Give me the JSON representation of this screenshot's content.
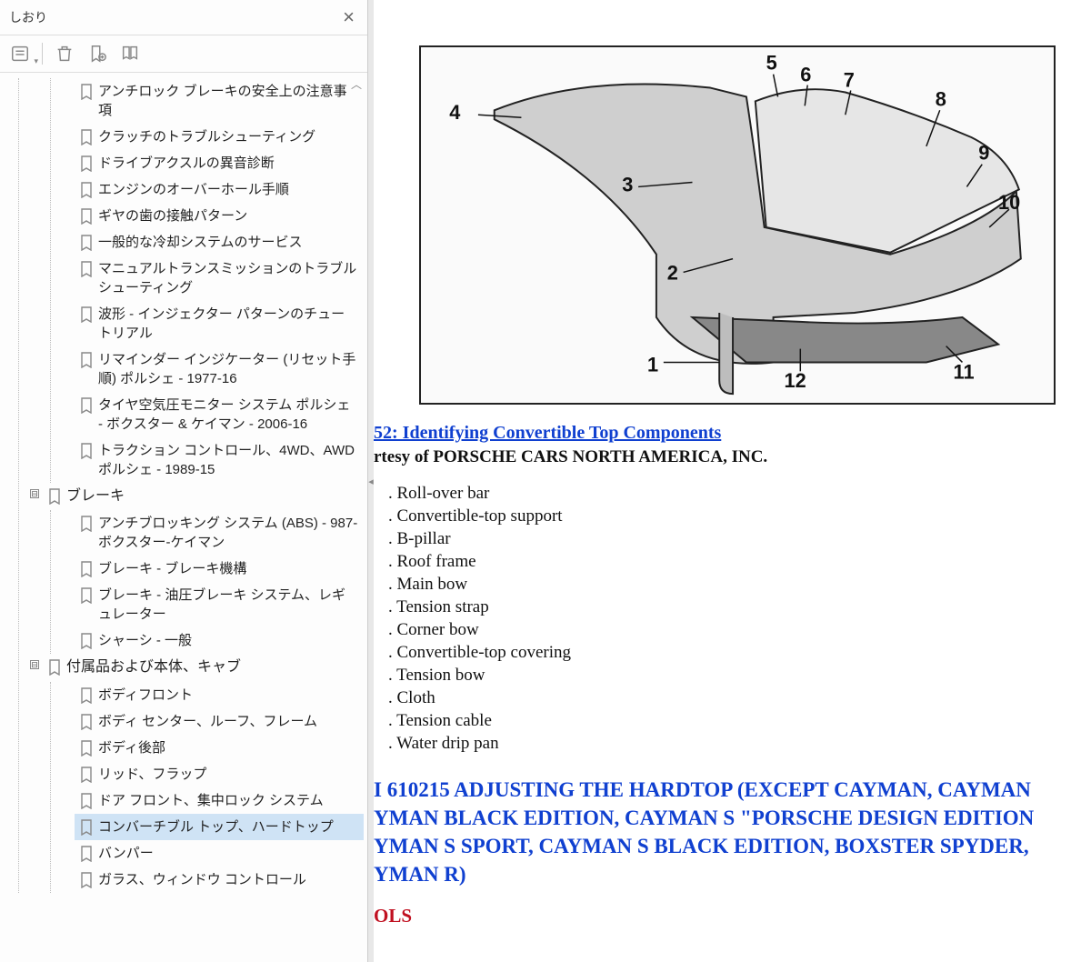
{
  "sidebar": {
    "title": "しおり",
    "close_label": "×",
    "bookmarks_level1": [
      "アンチロック ブレーキの安全上の注意事項",
      "クラッチのトラブルシューティング",
      "ドライブアクスルの異音診断",
      "エンジンのオーバーホール手順",
      "ギヤの歯の接触パターン",
      " 一般的な冷却システムのサービス",
      "マニュアルトランスミッションのトラブルシューティング",
      "波形 - インジェクター パターンのチュートリアル",
      "リマインダー インジケーター (リセット手順) ポルシェ - 1977-16",
      "タイヤ空気圧モニター システム ポルシェ - ボクスター & ケイマン - 2006-16",
      "トラクション コントロール、4WD、AWD ポルシェ - 1989-15"
    ],
    "group_brake": {
      "label": "ブレーキ",
      "children": [
        "アンチブロッキング システム (ABS) - 987-ボクスター-ケイマン",
        "ブレーキ - ブレーキ機構",
        "ブレーキ - 油圧ブレーキ システム、レギュレーター",
        "シャーシ - 一般"
      ]
    },
    "group_body": {
      "label": "付属品および本体、キャブ",
      "children": [
        "ボディフロント",
        " ボディ センター、ルーフ、フレーム",
        "ボディ後部",
        "リッド、フラップ",
        "ドア フロント、集中ロック システム",
        "コンバーチブル トップ、ハードトップ",
        "バンパー",
        "ガラス、ウィンドウ コントロール"
      ],
      "selected_index": 5
    }
  },
  "content": {
    "figure_caption": "52: Identifying Convertible Top Components",
    "courtesy": "rtesy of PORSCHE CARS NORTH AMERICA, INC.",
    "parts": [
      "Roll-over bar",
      "Convertible-top support",
      "B-pillar",
      "Roof frame",
      "Main bow",
      "Tension strap",
      "Corner bow",
      "Convertible-top covering",
      "Tension bow",
      "Cloth",
      "Tension cable",
      "Water drip pan"
    ],
    "section_heading": "I 610215 ADJUSTING THE HARDTOP (EXCEPT CAYMAN, CAYMAN YMAN BLACK EDITION, CAYMAN S \"PORSCHE DESIGN EDITION YMAN S SPORT, CAYMAN S BLACK EDITION, BOXSTER SPYDER, YMAN R)",
    "tools_heading": "OLS",
    "callouts": [
      "1",
      "2",
      "3",
      "4",
      "5",
      "6",
      "7",
      "8",
      "9",
      "10",
      "11",
      "12"
    ]
  }
}
